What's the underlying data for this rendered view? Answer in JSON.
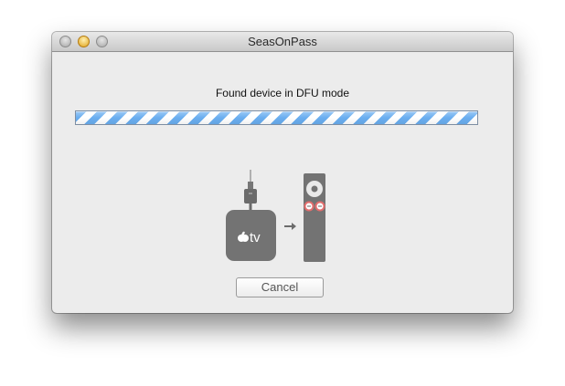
{
  "window": {
    "title": "SeasOnPass",
    "controls": [
      "close",
      "minimize",
      "zoom"
    ]
  },
  "status": {
    "message": "Found device in DFU mode"
  },
  "progress": {
    "state": "indeterminate",
    "colors": {
      "stripe": "#6aaef0",
      "background": "#ffffff"
    }
  },
  "illustration": {
    "device_label": "tv",
    "icons": [
      "usb-cable-icon",
      "apple-tv-icon",
      "arrow-right-icon",
      "apple-remote-icon"
    ],
    "highlight_color": "#e36d6d"
  },
  "buttons": {
    "cancel_label": "Cancel"
  }
}
